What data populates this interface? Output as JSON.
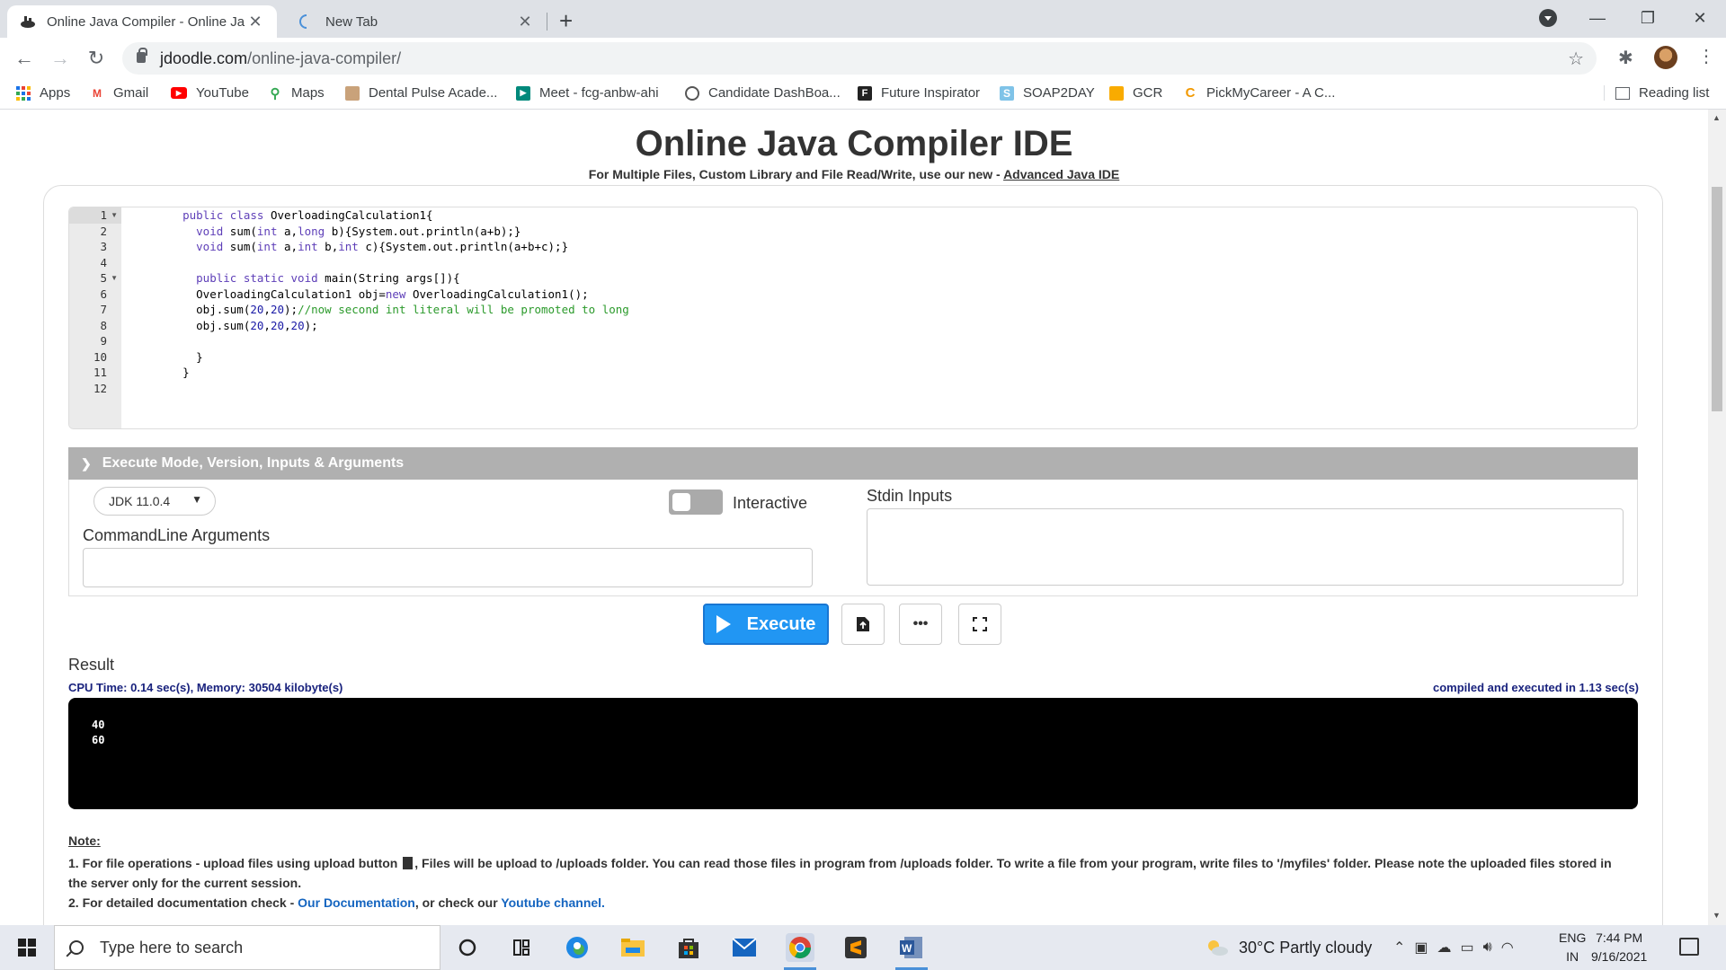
{
  "browser": {
    "tabs": [
      {
        "title": "Online Java Compiler - Online Ja",
        "active": true
      },
      {
        "title": "New Tab",
        "active": false
      }
    ],
    "url_host": "jdoodle.com",
    "url_path": "/online-java-compiler/",
    "window_controls": {
      "minimize": "—",
      "maximize": "❐",
      "close": "✕"
    }
  },
  "bookmarks": [
    {
      "label": "Apps",
      "icon": "apps-grid-icon"
    },
    {
      "label": "Gmail",
      "icon": "gmail-icon"
    },
    {
      "label": "YouTube",
      "icon": "youtube-icon"
    },
    {
      "label": "Maps",
      "icon": "maps-pin-icon"
    },
    {
      "label": "Dental Pulse Acade...",
      "icon": "dental-pulse-icon"
    },
    {
      "label": "Meet - fcg-anbw-ahi",
      "icon": "meet-icon"
    },
    {
      "label": "Candidate DashBoa...",
      "icon": "candidate-icon"
    },
    {
      "label": "Future Inspirator",
      "icon": "future-inspirator-icon"
    },
    {
      "label": "SOAP2DAY",
      "icon": "soap2day-icon"
    },
    {
      "label": "GCR",
      "icon": "gcr-icon"
    },
    {
      "label": "PickMyCareer - A C...",
      "icon": "pickmycareer-icon"
    }
  ],
  "reading_list": "Reading list",
  "page": {
    "title": "Online Java Compiler IDE",
    "subtitle_prefix": "For Multiple Files, Custom Library and File Read/Write, use our new - ",
    "subtitle_link": "Advanced Java IDE"
  },
  "editor": {
    "line_numbers": [
      "1",
      "2",
      "3",
      "4",
      "5",
      "6",
      "7",
      "8",
      "9",
      "10",
      "11",
      "12"
    ],
    "fold_lines": [
      1,
      5
    ]
  },
  "exec_panel": {
    "header": "Execute Mode, Version, Inputs & Arguments",
    "jdk_version": "JDK 11.0.4",
    "interactive_label": "Interactive",
    "interactive_on": false,
    "cmd_args_label": "CommandLine Arguments",
    "cmd_args_value": "",
    "stdin_label": "Stdin Inputs",
    "stdin_value": ""
  },
  "buttons": {
    "execute": "Execute",
    "more": "•••"
  },
  "result": {
    "label": "Result",
    "cpu_info": "CPU Time: 0.14 sec(s), Memory: 30504 kilobyte(s)",
    "compiled_info": "compiled and executed in 1.13 sec(s)",
    "output_lines": [
      "40",
      "60"
    ]
  },
  "notes": {
    "title": "Note:",
    "line1_a": "1. For file operations - upload files using upload button ",
    "line1_b": ", Files will be upload to /uploads folder. You can read those files in program from /uploads folder. To write a file from your program, write files to '/myfiles' folder. Please note the uploaded files stored in the server only for the current session.",
    "line2_a": "2. For detailed documentation check - ",
    "line2_link1": "Our Documentation",
    "line2_b": ", or check our ",
    "line2_link2": "Youtube channel."
  },
  "taskbar": {
    "search_placeholder": "Type here to search",
    "weather": "30°C  Partly cloudy",
    "lang_top": "ENG",
    "lang_bottom": "IN",
    "time": "7:44 PM",
    "date": "9/16/2021",
    "pinned_icons": [
      "cortana-icon",
      "task-view-icon",
      "edge-icon",
      "file-explorer-icon",
      "store-icon",
      "mail-icon",
      "chrome-icon",
      "sublime-text-icon",
      "word-icon"
    ]
  },
  "colors": {
    "execute_blue": "#2196f3",
    "header_gray": "#b0b0b0",
    "info_navy": "#1a237e",
    "link_blue": "#1565c0"
  }
}
